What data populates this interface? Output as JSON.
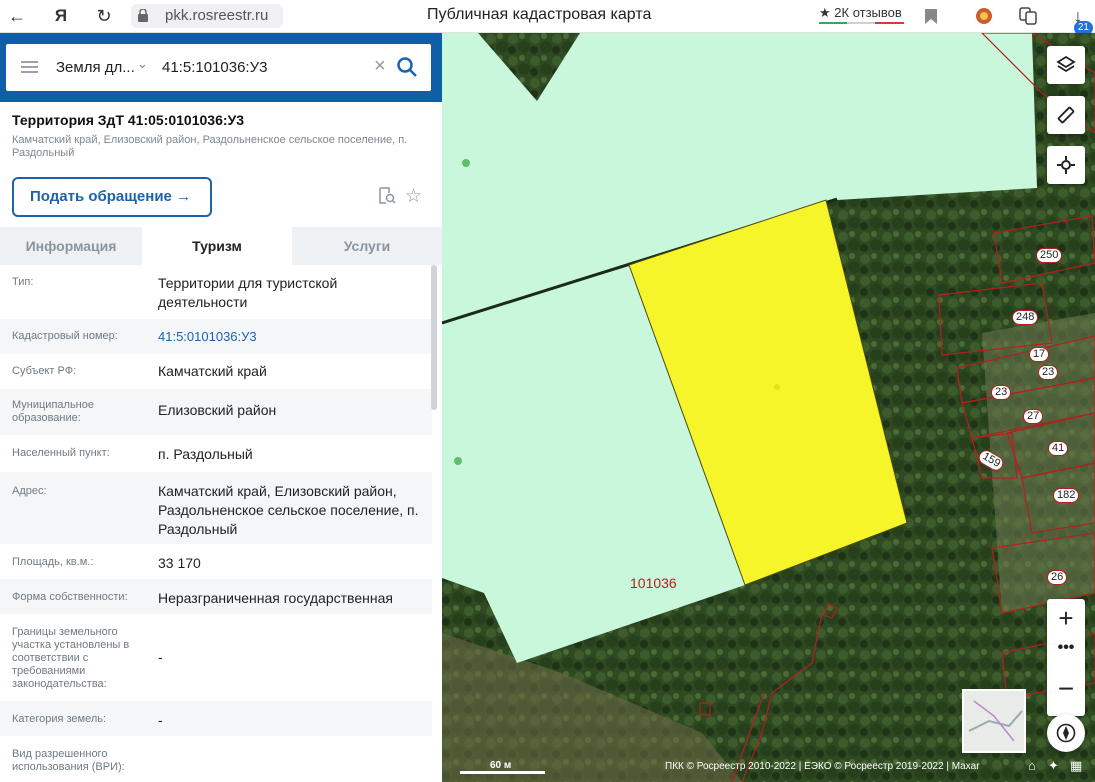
{
  "browser": {
    "url": "pkk.rosreestr.ru",
    "page_title": "Публичная кадастровая карта",
    "reviews": "2К отзывов",
    "downloads_badge": "21"
  },
  "search": {
    "filter": "Земля дл...",
    "value": "41:5:101036:У3"
  },
  "object": {
    "title": "Территория ЗдТ 41:05:0101036:У3",
    "subtitle": "Камчатский край, Елизовский район, Раздольненское сельское поселение, п. Раздольный",
    "appeal_button": "Подать обращение"
  },
  "tabs": [
    {
      "label": "Информация"
    },
    {
      "label": "Туризм"
    },
    {
      "label": "Услуги"
    }
  ],
  "active_tab": "Туризм",
  "rows": [
    {
      "label": "Тип:",
      "value": "Территории для туристской деятельности"
    },
    {
      "label": "Кадастровый номер:",
      "value": "41:5:0101036:У3"
    },
    {
      "label": "Субъект РФ:",
      "value": "Камчатский край"
    },
    {
      "label": "Муниципальное образование:",
      "value": "Елизовский район"
    },
    {
      "label": "Населенный пункт:",
      "value": "п. Раздольный"
    },
    {
      "label": "Адрес:",
      "value": "Камчатский край, Елизовский район, Раздольненское сельское поселение, п. Раздольный"
    },
    {
      "label": "Площадь, кв.м.:",
      "value": "33 170"
    },
    {
      "label": "Форма собственности:",
      "value": "Неразграниченная государственная"
    },
    {
      "label": "Границы земельного участка установлены в соответствии с требованиями законодательства:",
      "value": "-"
    },
    {
      "label": "Категория земель:",
      "value": "-"
    },
    {
      "label": "Вид разрешенного использования (ВРИ):",
      "value": ""
    }
  ],
  "map": {
    "quarter_label": "101036",
    "lot_labels": [
      "250",
      "248",
      "17",
      "23",
      "23",
      "27",
      "159",
      "41",
      "182",
      "26"
    ],
    "scale": "60 м",
    "copyright": "ПКК © Росреестр 2010-2022 | ЕЭКО © Росреестр 2019-2022 | Maxar",
    "colors": {
      "highlight": "#f5f52a",
      "zone": "#c8f7dc",
      "boundary": "#b51f1f"
    }
  }
}
